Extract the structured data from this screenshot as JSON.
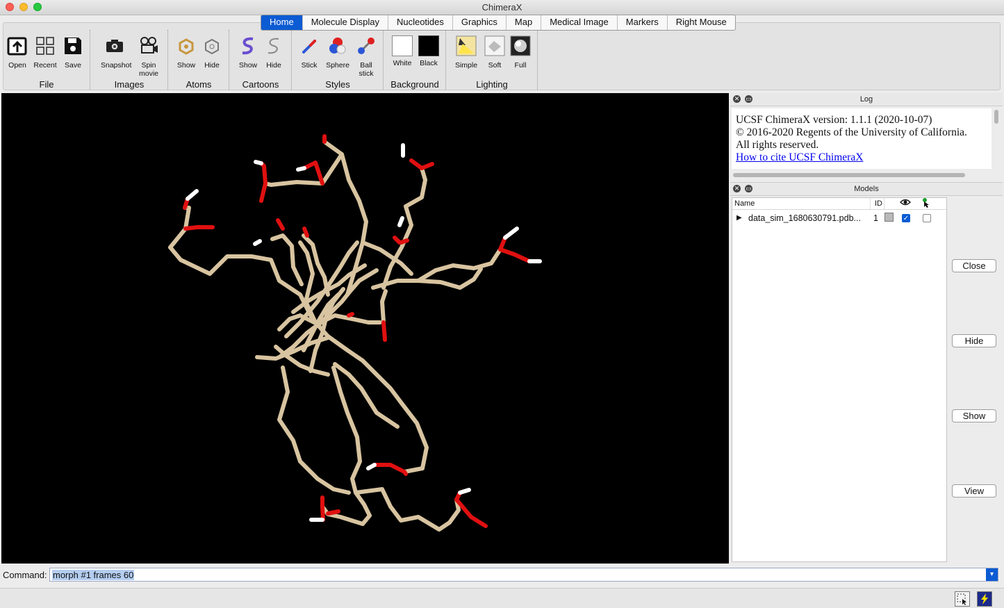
{
  "window": {
    "title": "ChimeraX"
  },
  "tabs": [
    {
      "label": "Home",
      "active": true
    },
    {
      "label": "Molecule Display"
    },
    {
      "label": "Nucleotides"
    },
    {
      "label": "Graphics"
    },
    {
      "label": "Map"
    },
    {
      "label": "Medical Image"
    },
    {
      "label": "Markers"
    },
    {
      "label": "Right Mouse"
    }
  ],
  "ribbon": {
    "groups": {
      "file": "File",
      "images": "Images",
      "atoms": "Atoms",
      "cartoons": "Cartoons",
      "styles": "Styles",
      "background": "Background",
      "lighting": "Lighting"
    },
    "tools": {
      "open": "Open",
      "recent": "Recent",
      "save": "Save",
      "snapshot": "Snapshot",
      "spin_movie": "Spin movie",
      "atoms_show": "Show",
      "atoms_hide": "Hide",
      "cartoons_show": "Show",
      "cartoons_hide": "Hide",
      "stick": "Stick",
      "sphere": "Sphere",
      "ball_stick": "Ball stick",
      "white": "White",
      "black": "Black",
      "simple": "Simple",
      "soft": "Soft",
      "full": "Full"
    }
  },
  "log": {
    "title": "Log",
    "line1": "UCSF ChimeraX version: 1.1.1 (2020-10-07)",
    "line2": "© 2016-2020 Regents of the University of California.",
    "line3": "All rights reserved.",
    "link": "How to cite UCSF ChimeraX"
  },
  "models": {
    "title": "Models",
    "headers": {
      "name": "Name",
      "id": "ID"
    },
    "rows": [
      {
        "name": "data_sim_1680630791.pdb...",
        "id": "1",
        "shown": true,
        "selected": false
      }
    ],
    "buttons": {
      "close": "Close",
      "hide": "Hide",
      "show": "Show",
      "view": "View"
    }
  },
  "command": {
    "label": "Command:",
    "value": "morph #1 frames 60"
  },
  "colors": {
    "accent": "#0b5bd3",
    "viewer_bg": "#000000",
    "carbon": "#d8c4a0",
    "oxygen": "#e01010",
    "hydrogen": "#ffffff"
  }
}
